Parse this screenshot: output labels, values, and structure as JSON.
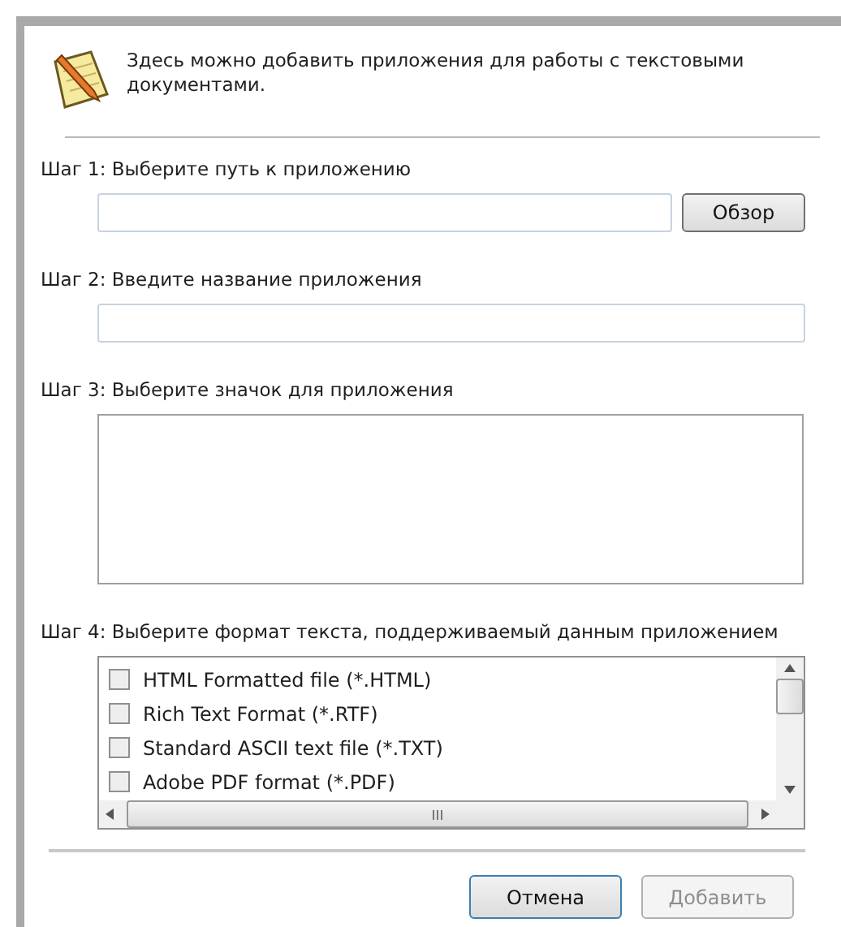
{
  "intro": "Здесь можно добавить приложения для работы с текстовыми документами.",
  "steps": [
    {
      "kind": "path",
      "label": "Шаг 1: Выберите путь к приложению",
      "button": "Обзор"
    },
    {
      "kind": "name",
      "label": "Шаг 2: Введите название приложения"
    },
    {
      "kind": "icon",
      "label": "Шаг 3: Выберите значок для приложения"
    },
    {
      "kind": "formats",
      "label": "Шаг 4: Выберите формат текста, поддерживаемый данным приложением",
      "formats": [
        {
          "label": "HTML Formatted file (*.HTML)",
          "checked": false
        },
        {
          "label": "Rich Text Format (*.RTF)",
          "checked": false
        },
        {
          "label": "Standard ASCII text file (*.TXT)",
          "checked": false
        },
        {
          "label": "Adobe PDF format (*.PDF)",
          "checked": false
        }
      ]
    }
  ],
  "buttons": [
    {
      "label": "Отмена",
      "disabled": false,
      "default": true
    },
    {
      "label": "Добавить",
      "disabled": true,
      "default": false
    }
  ]
}
